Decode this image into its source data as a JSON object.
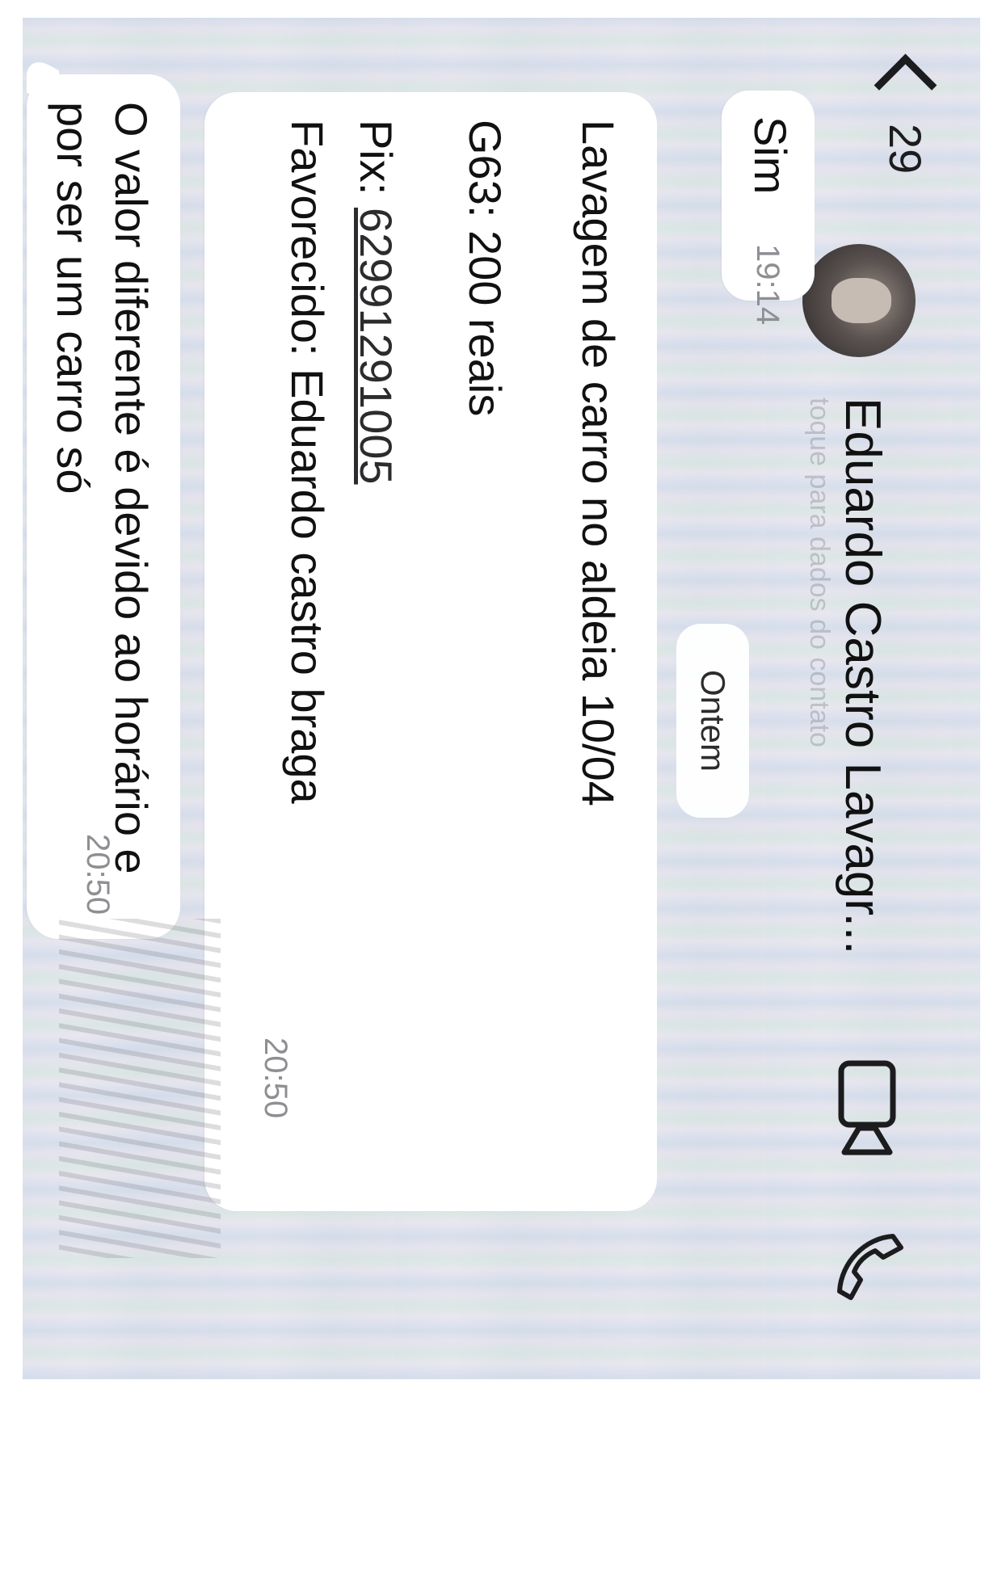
{
  "header": {
    "back_count": "29",
    "contact_name": "Eduardo Castro Lavagr...",
    "contact_subtitle": "toque para dados do contato"
  },
  "chat": {
    "date_separator": "Ontem",
    "messages": [
      {
        "text": "Sim",
        "time": "19:14"
      },
      {
        "lines": [
          "Lavagem de carro no aldeia 10/04",
          "G63: 200 reais",
          "Pix: ",
          "Favorecido: Eduardo castro braga"
        ],
        "pix_number": "62991291005",
        "time": "20:50"
      },
      {
        "lines": [
          "O valor diferente é devido ao horário e",
          "por ser um carro só"
        ],
        "time": "20:50"
      }
    ]
  },
  "icons": {
    "back": "chevron-left-icon",
    "video": "video-call-icon",
    "phone": "phone-call-icon"
  }
}
